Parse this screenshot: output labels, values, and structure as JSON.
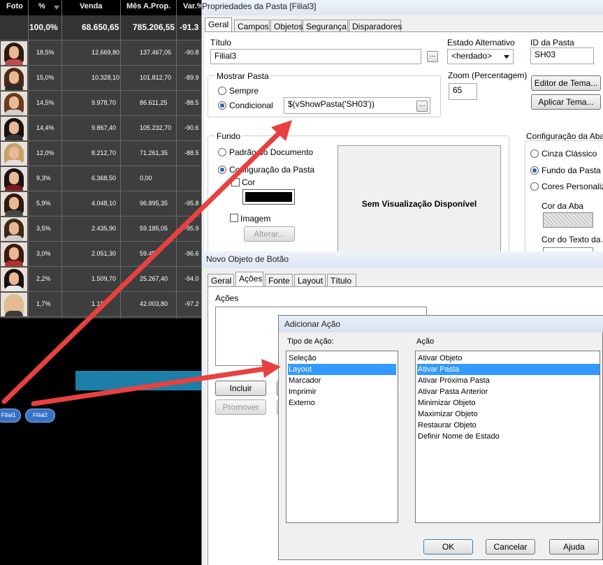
{
  "table": {
    "headers": [
      "Foto",
      "%",
      "Venda",
      "Mês A.Prop.",
      "Var.%"
    ],
    "total": {
      "pct": "100,0%",
      "venda": "68.650,65",
      "mes": "785.206,55",
      "var": "-91.3"
    },
    "rows": [
      {
        "pct": "18,5%",
        "venda": "12.669,80",
        "mes": "137.467,05",
        "var": "-90.8"
      },
      {
        "pct": "15,0%",
        "venda": "10.328,10",
        "mes": "101.812,70",
        "var": "-89.9"
      },
      {
        "pct": "14,5%",
        "venda": "9.978,70",
        "mes": "86.611,25",
        "var": "-88.5"
      },
      {
        "pct": "14,4%",
        "venda": "9.867,40",
        "mes": "105.232,70",
        "var": "-90.6"
      },
      {
        "pct": "12,0%",
        "venda": "8.212,70",
        "mes": "71.261,35",
        "var": "-88.5"
      },
      {
        "pct": "9,3%",
        "venda": "6.368,50",
        "mes": "0,00",
        "var": ""
      },
      {
        "pct": "5,9%",
        "venda": "4.048,10",
        "mes": "96.895,35",
        "var": "-95.8"
      },
      {
        "pct": "3,5%",
        "venda": "2.435,90",
        "mes": "59.185,05",
        "var": "-95.9"
      },
      {
        "pct": "3,0%",
        "venda": "2.051,30",
        "mes": "59.45",
        "var": "-96.6"
      },
      {
        "pct": "2,2%",
        "venda": "1.509,70",
        "mes": "25.267,40",
        "var": "-94.0"
      },
      {
        "pct": "1,7%",
        "venda": "1.18",
        "mes": "42.003,80",
        "var": "-97.2"
      }
    ],
    "photo_colors": [
      {
        "hair": "#2a1a12",
        "shirt": "#c24a4a"
      },
      {
        "hair": "#4a2a1a",
        "shirt": "#2a2a2a"
      },
      {
        "hair": "#6b3a1e",
        "shirt": "#d0d0d0"
      },
      {
        "hair": "#1a1210",
        "shirt": "#333"
      },
      {
        "hair": "#c8a06a",
        "shirt": "#e0e0e0"
      },
      {
        "hair": "#1a1210",
        "shirt": "#7a1a1a"
      },
      {
        "hair": "#2a1a10",
        "shirt": "#444"
      },
      {
        "hair": "#3a2a1a",
        "shirt": "#cfcfcf"
      },
      {
        "hair": "#3a1a10",
        "shirt": "#b03030"
      },
      {
        "hair": "#1a1010",
        "shirt": "#eaeaea"
      },
      {
        "hair": "#d8c090",
        "shirt": "#3a3a3a"
      }
    ]
  },
  "sheet_tabs": [
    "Filial1",
    "Filial2"
  ],
  "props": {
    "title": "Propriedades da Pasta [Filial3]",
    "tabs": [
      "Geral",
      "Campos",
      "Objetos",
      "Segurança",
      "Disparadores"
    ],
    "titulo_label": "Título",
    "titulo_value": "Filial3",
    "estado_label": "Estado Alternativo",
    "estado_value": "<herdado>",
    "id_label": "ID da Pasta",
    "id_value": "SH03",
    "mostrar_label": "Mostrar Pasta",
    "sempre": "Sempre",
    "condicional": "Condicional",
    "cond_value": "$(vShowPasta('SH03'))",
    "zoom_label": "Zoom (Percentagem)",
    "zoom_value": "65",
    "editor_btn": "Editor de Tema...",
    "aplicar_btn": "Aplicar Tema...",
    "fundo_label": "Fundo",
    "padrao": "Padrão do Documento",
    "config_pasta": "Configuração da Pasta",
    "cor": "Cor",
    "imagem": "Imagem",
    "alterar": "Alterar...",
    "preview": "Sem Visualização Disponível",
    "aba_label": "Configuração da Aba",
    "cinza": "Cinza Clássico",
    "fundo_pasta": "Fundo da Pasta",
    "cores_pers": "Cores Personalizadas",
    "cor_aba": "Cor da Aba",
    "cor_texto": "Cor do Texto da Aba"
  },
  "button_dialog": {
    "title": "Novo Objeto de Botão",
    "tabs": [
      "Geral",
      "Ações",
      "Fonte",
      "Layout",
      "Título"
    ],
    "acoes_label": "Ações",
    "incluir": "Incluir",
    "promover": "Promover"
  },
  "add_action": {
    "title": "Adicionar Ação",
    "tipo_label": "Tipo de Ação:",
    "acao_label": "Ação",
    "tipos": [
      "Seleção",
      "Layout",
      "Marcador",
      "Imprimir",
      "Externo"
    ],
    "tipo_selected": 1,
    "acoes": [
      "Ativar Objeto",
      "Ativar Pasta",
      "Ativar Próxima Pasta",
      "Ativar Pasta Anterior",
      "Minimizar Objeto",
      "Maximizar Objeto",
      "Restaurar Objeto",
      "Definir Nome de Estado"
    ],
    "acao_selected": 1,
    "ok": "OK",
    "cancelar": "Cancelar",
    "ajuda": "Ajuda"
  },
  "colors": {
    "arrow": "#e8413f",
    "selection": "#3399ff",
    "teal": "#1c7fa8"
  }
}
